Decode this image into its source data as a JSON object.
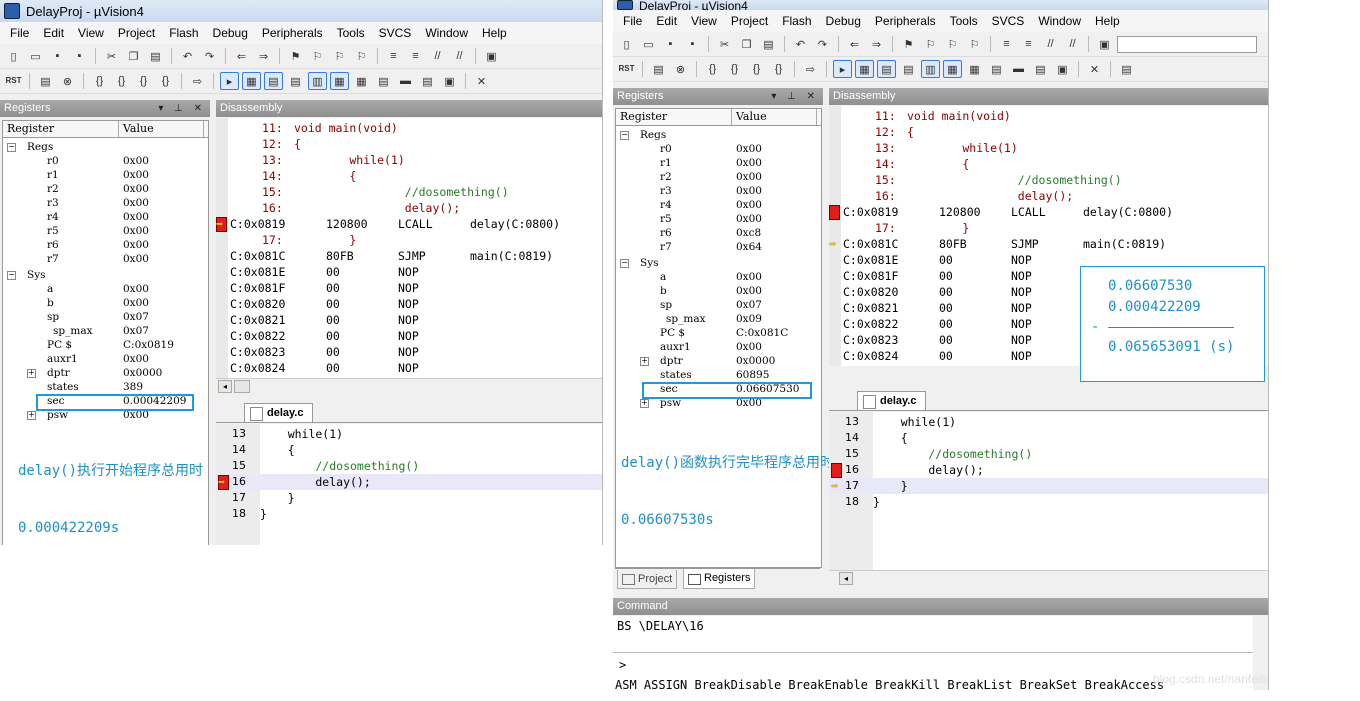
{
  "left": {
    "title": "DelayProj - µVision4",
    "menu": [
      "File",
      "Edit",
      "View",
      "Project",
      "Flash",
      "Debug",
      "Peripherals",
      "Tools",
      "SVCS",
      "Window",
      "Help"
    ],
    "registers_pane_title": "Registers",
    "disassembly_pane_title": "Disassembly",
    "reg_col_register": "Register",
    "reg_col_value": "Value",
    "regs_group": "Regs",
    "sys_group": "Sys",
    "regs": [
      {
        "n": "r0",
        "v": "0x00"
      },
      {
        "n": "r1",
        "v": "0x00"
      },
      {
        "n": "r2",
        "v": "0x00"
      },
      {
        "n": "r3",
        "v": "0x00"
      },
      {
        "n": "r4",
        "v": "0x00"
      },
      {
        "n": "r5",
        "v": "0x00"
      },
      {
        "n": "r6",
        "v": "0x00"
      },
      {
        "n": "r7",
        "v": "0x00"
      }
    ],
    "sys": [
      {
        "n": "a",
        "v": "0x00"
      },
      {
        "n": "b",
        "v": "0x00"
      },
      {
        "n": "sp",
        "v": "0x07"
      },
      {
        "n": "sp_max",
        "v": "0x07"
      },
      {
        "n": "PC  $",
        "v": "C:0x0819"
      },
      {
        "n": "auxr1",
        "v": "0x00"
      },
      {
        "n": "dptr",
        "v": "0x0000"
      },
      {
        "n": "states",
        "v": "389"
      },
      {
        "n": "sec",
        "v": "0.00042209"
      },
      {
        "n": "psw",
        "v": "0x00"
      }
    ],
    "disasm": [
      {
        "ln": "11:",
        "src": "void main(void)"
      },
      {
        "ln": "12:",
        "src": "{"
      },
      {
        "ln": "13:",
        "src": "        while(1)"
      },
      {
        "ln": "14:",
        "src": "        {"
      },
      {
        "ln": "15:",
        "src": "                //dosomething()"
      },
      {
        "ln": "16:",
        "src": "                delay();"
      },
      {
        "addr": "C:0x0819",
        "op": "120800",
        "mn": "LCALL",
        "arg": "delay(C:0800)"
      },
      {
        "ln": "17:",
        "src": "        }"
      },
      {
        "addr": "C:0x081C",
        "op": "80FB",
        "mn": "SJMP",
        "arg": "main(C:0819)"
      },
      {
        "addr": "C:0x081E",
        "op": "00",
        "mn": "NOP",
        "arg": ""
      },
      {
        "addr": "C:0x081F",
        "op": "00",
        "mn": "NOP",
        "arg": ""
      },
      {
        "addr": "C:0x0820",
        "op": "00",
        "mn": "NOP",
        "arg": ""
      },
      {
        "addr": "C:0x0821",
        "op": "00",
        "mn": "NOP",
        "arg": ""
      },
      {
        "addr": "C:0x0822",
        "op": "00",
        "mn": "NOP",
        "arg": ""
      },
      {
        "addr": "C:0x0823",
        "op": "00",
        "mn": "NOP",
        "arg": ""
      },
      {
        "addr": "C:0x0824",
        "op": "00",
        "mn": "NOP",
        "arg": ""
      }
    ],
    "tab": "delay.c",
    "source": [
      {
        "ln": "13",
        "tx": "    while(1)"
      },
      {
        "ln": "14",
        "tx": "    {"
      },
      {
        "ln": "15",
        "tx": "        //dosomething()"
      },
      {
        "ln": "16",
        "tx": "        delay();"
      },
      {
        "ln": "17",
        "tx": "    }"
      },
      {
        "ln": "18",
        "tx": "}"
      }
    ],
    "annotation_line1": "delay()执行开始程序总用时",
    "annotation_line2": "0.000422209s"
  },
  "right": {
    "title": "DelayProj - µVision4",
    "menu": [
      "File",
      "Edit",
      "View",
      "Project",
      "Flash",
      "Debug",
      "Peripherals",
      "Tools",
      "SVCS",
      "Window",
      "Help"
    ],
    "registers_pane_title": "Registers",
    "disassembly_pane_title": "Disassembly",
    "reg_col_register": "Register",
    "reg_col_value": "Value",
    "regs_group": "Regs",
    "sys_group": "Sys",
    "regs": [
      {
        "n": "r0",
        "v": "0x00"
      },
      {
        "n": "r1",
        "v": "0x00"
      },
      {
        "n": "r2",
        "v": "0x00"
      },
      {
        "n": "r3",
        "v": "0x00"
      },
      {
        "n": "r4",
        "v": "0x00"
      },
      {
        "n": "r5",
        "v": "0x00"
      },
      {
        "n": "r6",
        "v": "0xc8"
      },
      {
        "n": "r7",
        "v": "0x64"
      }
    ],
    "sys": [
      {
        "n": "a",
        "v": "0x00"
      },
      {
        "n": "b",
        "v": "0x00"
      },
      {
        "n": "sp",
        "v": "0x07"
      },
      {
        "n": "sp_max",
        "v": "0x09"
      },
      {
        "n": "PC  $",
        "v": "C:0x081C"
      },
      {
        "n": "auxr1",
        "v": "0x00"
      },
      {
        "n": "dptr",
        "v": "0x0000"
      },
      {
        "n": "states",
        "v": "60895"
      },
      {
        "n": "sec",
        "v": "0.06607530"
      },
      {
        "n": "psw",
        "v": "0x00"
      }
    ],
    "disasm": [
      {
        "ln": "11:",
        "src": "void main(void)"
      },
      {
        "ln": "12:",
        "src": "{"
      },
      {
        "ln": "13:",
        "src": "        while(1)"
      },
      {
        "ln": "14:",
        "src": "        {"
      },
      {
        "ln": "15:",
        "src": "                //dosomething()"
      },
      {
        "ln": "16:",
        "src": "                delay();"
      },
      {
        "addr": "C:0x0819",
        "op": "120800",
        "mn": "LCALL",
        "arg": "delay(C:0800)"
      },
      {
        "ln": "17:",
        "src": "        }"
      },
      {
        "addr": "C:0x081C",
        "op": "80FB",
        "mn": "SJMP",
        "arg": "main(C:0819)"
      },
      {
        "addr": "C:0x081E",
        "op": "00",
        "mn": "NOP",
        "arg": ""
      },
      {
        "addr": "C:0x081F",
        "op": "00",
        "mn": "NOP",
        "arg": ""
      },
      {
        "addr": "C:0x0820",
        "op": "00",
        "mn": "NOP",
        "arg": ""
      },
      {
        "addr": "C:0x0821",
        "op": "00",
        "mn": "NOP",
        "arg": ""
      },
      {
        "addr": "C:0x0822",
        "op": "00",
        "mn": "NOP",
        "arg": ""
      },
      {
        "addr": "C:0x0823",
        "op": "00",
        "mn": "NOP",
        "arg": ""
      },
      {
        "addr": "C:0x0824",
        "op": "00",
        "mn": "NOP",
        "arg": ""
      }
    ],
    "tab": "delay.c",
    "source": [
      {
        "ln": "13",
        "tx": "    while(1)"
      },
      {
        "ln": "14",
        "tx": "    {"
      },
      {
        "ln": "15",
        "tx": "        //dosomething()"
      },
      {
        "ln": "16",
        "tx": "        delay();"
      },
      {
        "ln": "17",
        "tx": "    }"
      },
      {
        "ln": "18",
        "tx": "}"
      }
    ],
    "bottom_tab_project": "Project",
    "bottom_tab_registers": "Registers",
    "annotation_line1": "delay()函数执行完毕程序总用时",
    "annotation_line2": "0.06607530s",
    "calc_line1": "0.06607530",
    "calc_line2": "0.000422209",
    "calc_minus": "-",
    "calc_result": "0.065653091 (s)",
    "command_title": "Command",
    "command_output": "BS \\DELAY\\16",
    "command_prompt": ">",
    "command_hints": "ASM ASSIGN BreakDisable BreakEnable BreakKill BreakList BreakSet BreakAccess",
    "watermark": "blog.csdn.net/nanfeibuyi"
  }
}
